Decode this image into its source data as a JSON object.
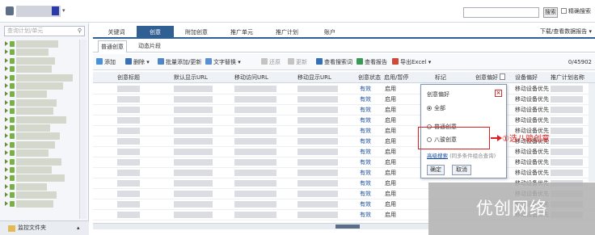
{
  "top": {
    "search_btn": "搜索",
    "precise_label": "精确搜索"
  },
  "sidebar": {
    "search_placeholder": "查询计划/单元",
    "footer_label": "监控文件夹"
  },
  "main_tabs": [
    {
      "label": "关键词"
    },
    {
      "label": "创意"
    },
    {
      "label": "附加创意"
    },
    {
      "label": "推广单元"
    },
    {
      "label": "推广计划"
    },
    {
      "label": "账户"
    }
  ],
  "download_label": "下载/查看数据报告 ▾",
  "sub_tabs": [
    {
      "label": "普通创意"
    },
    {
      "label": "动态片段"
    }
  ],
  "toolbar": {
    "add": "添加",
    "delete": "删除",
    "batch": "批量添加/更新",
    "replace": "文字替换",
    "restore": "还原",
    "update": "更新",
    "view_search": "查看搜索词",
    "view_report": "查看报告",
    "export": "导出Excel",
    "count": "0/45902"
  },
  "columns": [
    {
      "label": "创意标题"
    },
    {
      "label": "默认显示URL"
    },
    {
      "label": "移动访问URL"
    },
    {
      "label": "移动显示URL"
    },
    {
      "label": "创意状态"
    },
    {
      "label": "启用/暂停"
    },
    {
      "label": "标记"
    },
    {
      "label": "创意偏好"
    },
    {
      "label": "设备偏好"
    },
    {
      "label": "推广计划名称"
    }
  ],
  "rows": [
    {
      "status": "有效",
      "enabled": "启用",
      "device": "移动设备优先"
    },
    {
      "status": "有效",
      "enabled": "启用",
      "device": "移动设备优先"
    },
    {
      "status": "有效",
      "enabled": "启用",
      "device": "移动设备优先"
    },
    {
      "status": "有效",
      "enabled": "启用",
      "device": "移动设备优先"
    },
    {
      "status": "有效",
      "enabled": "启用",
      "device": "移动设备优先"
    },
    {
      "status": "有效",
      "enabled": "启用",
      "device": "移动设备优先"
    },
    {
      "status": "有效",
      "enabled": "启用",
      "device": "移动设备优先"
    },
    {
      "status": "有效",
      "enabled": "启用",
      "device": "移动设备优先"
    },
    {
      "status": "有效",
      "enabled": "启用",
      "device": "移动设备优先"
    },
    {
      "status": "有效",
      "enabled": "启用",
      "device": "移动设备优先"
    },
    {
      "status": "有效",
      "enabled": "启用",
      "device": "移动设备优先"
    },
    {
      "status": "有效",
      "enabled": "启用",
      "device": "移动设备优先"
    },
    {
      "status": "有效",
      "enabled": "启用",
      "device": "移动设备优先"
    }
  ],
  "popup": {
    "title": "创意偏好",
    "opt_all": "全部",
    "opt_normal": "普通创意",
    "opt_bajun": "八骏创意",
    "adv_link": "高级搜索",
    "adv_hint": "(同多条件组合查询)",
    "ok": "确定",
    "cancel": "取消"
  },
  "annotation": "①选八骏创意",
  "watermark": "优创网络",
  "colors": {
    "accent": "#2f5f93",
    "annotation": "#e02020",
    "status": "#1a4fa0"
  }
}
